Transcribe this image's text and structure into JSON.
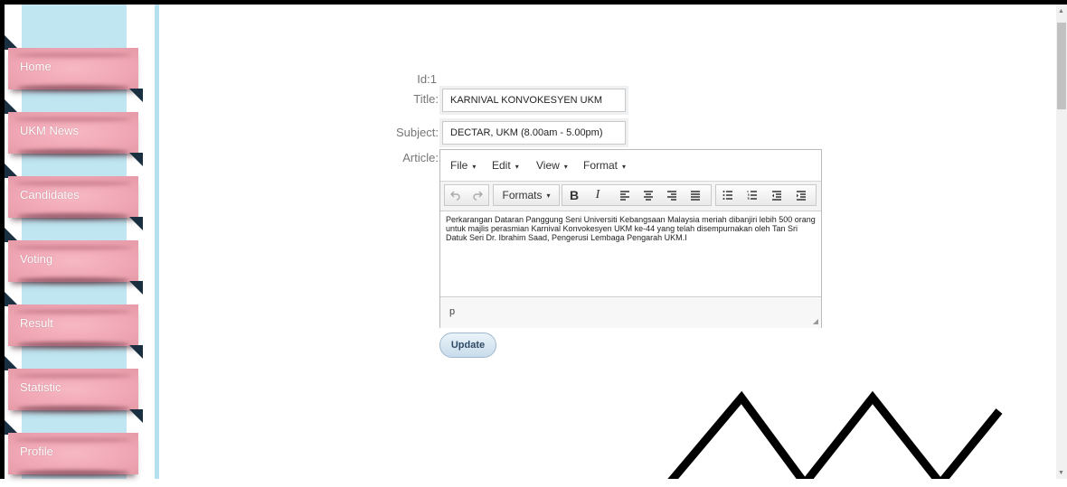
{
  "sidebar": {
    "items": [
      {
        "label": "Home"
      },
      {
        "label": "UKM News"
      },
      {
        "label": "Candidates"
      },
      {
        "label": "Voting"
      },
      {
        "label": "Result"
      },
      {
        "label": "Statistic"
      },
      {
        "label": "Profile"
      }
    ]
  },
  "form": {
    "id_label": "Id:",
    "id_value": "1",
    "title_label": "Title:",
    "title_value": "KARNIVAL KONVOKESYEN UKM",
    "subject_label": "Subject:",
    "subject_value": "DECTAR, UKM (8.00am - 5.00pm)",
    "article_label": "Article:"
  },
  "editor": {
    "menus": [
      "File",
      "Edit",
      "View",
      "Format"
    ],
    "formats_label": "Formats",
    "content": "Perkarangan Dataran Panggung Seni Universiti Kebangsaan Malaysia meriah dibanjiri lebih 500 orang untuk majlis perasmian Karnival Konvokesyen UKM ke-44 yang telah disempurnakan oleh Tan Sri Datuk Seri Dr. Ibrahim Saad, Pengerusi Lembaga Pengarah UKM.I",
    "status_path": "p"
  },
  "update_label": "Update",
  "colors": {
    "sidebar_band": "#bfe6f1",
    "nav_pill": "#f1a8b6",
    "accent_triangle": "#1a3040"
  }
}
